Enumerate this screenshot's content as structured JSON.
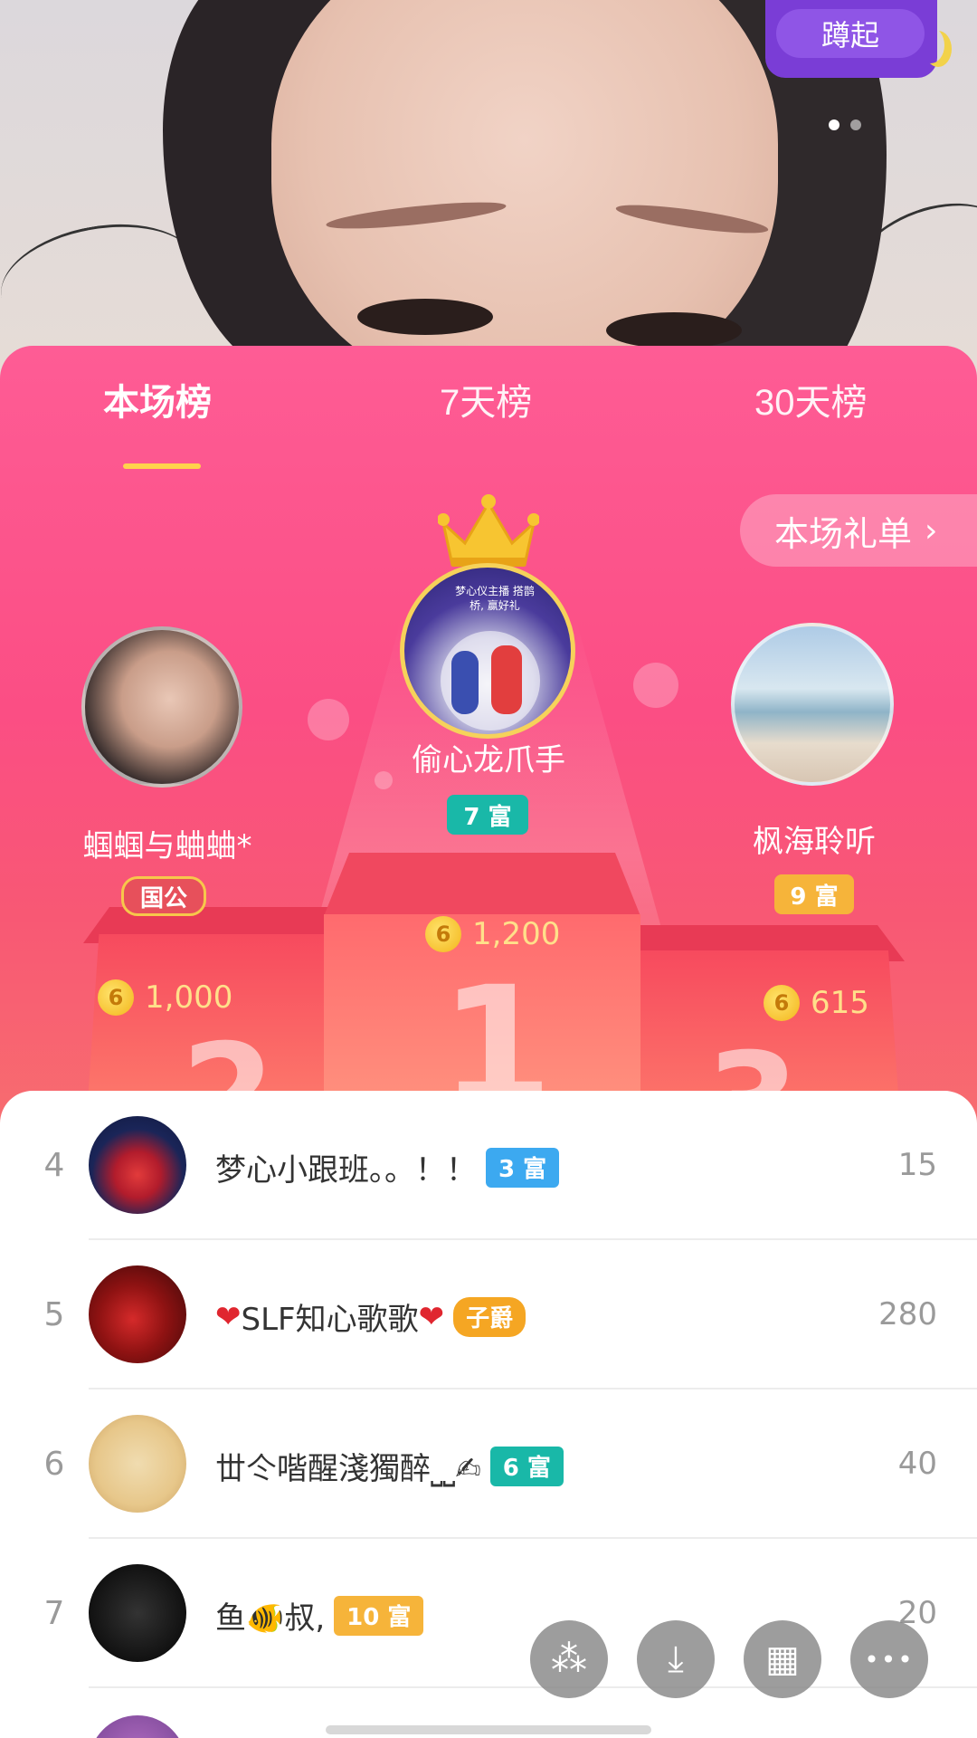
{
  "live": {
    "follow_label": "蹲起",
    "page_dots": 2,
    "active_page": 1
  },
  "tabs": [
    {
      "label": "本场榜",
      "active": true
    },
    {
      "label": "7天榜",
      "active": false
    },
    {
      "label": "30天榜",
      "active": false
    }
  ],
  "gift_list_button": {
    "label": "本场礼单",
    "icon": "chevron-right-icon"
  },
  "top3": {
    "first": {
      "name": "偷心龙爪手",
      "badge": "7 富",
      "badge_color": "#19b8a8",
      "score": "1,200",
      "podium": "1",
      "avatar_text": "梦心仪主播 搭鹊桥, 赢好礼"
    },
    "second": {
      "name": "蝈蝈与蛐蛐*",
      "badge": "国公",
      "badge_color": "#e7505b",
      "score": "1,000",
      "podium": "2"
    },
    "third": {
      "name": "枫海聆听",
      "badge": "9 富",
      "badge_color": "#f6b43a",
      "score": "615",
      "podium": "3"
    }
  },
  "coin_glyph": "6",
  "list": [
    {
      "rank": "4",
      "name": "梦心小跟班。。！！",
      "badge": "3 富",
      "badge_color": "#3ca9f0",
      "score": "15"
    },
    {
      "rank": "5",
      "name_prefix": "❤",
      "name": "SLF知心歌歌",
      "name_suffix": "❤",
      "badge": "子爵",
      "badge_color": "#f5a623",
      "score": "280"
    },
    {
      "rank": "6",
      "name": "丗仒喈醒淺獨醉⎵⎵✍",
      "badge": "6 富",
      "badge_color": "#19b8a8",
      "score": "40"
    },
    {
      "rank": "7",
      "name": "鱼🐠叔,",
      "badge": "10 富",
      "badge_color": "#f6b43a",
      "score": "20"
    }
  ],
  "fabs": [
    {
      "icon": "sparkle-icon",
      "glyph": "⁂"
    },
    {
      "icon": "download-icon",
      "glyph": "⤓"
    },
    {
      "icon": "grid-icon",
      "glyph": "▦"
    },
    {
      "icon": "more-icon",
      "glyph": "•••"
    }
  ]
}
